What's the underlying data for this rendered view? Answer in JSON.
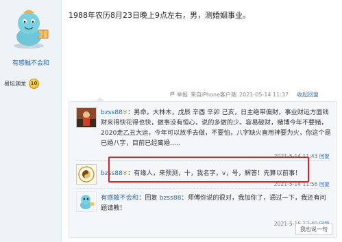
{
  "sidebar": {
    "username": "有感触不会和",
    "rank_label": "易坛渊龙",
    "level": "10"
  },
  "post": {
    "text": "1988年农历8月23日晚上9点左右，男，测婚姻事业。",
    "report": "举报",
    "source": "来自iPhone客户端",
    "date": "2021-05-14 11:37",
    "collapse_reply": "收起回复"
  },
  "replies": [
    {
      "name": "bzss88",
      "text": "：男命，大林木，戊辰 辛酉 辛卯 己亥，日主绝带偏财，事业财运方面钱财来得快花得也快，做事没有恒心，说的多做的少。容易破财，赌博今年不要赌，2020走乙丑大运，今年可以放手去做，不要怕，八字缺火喜用神要为火，你这个是已婚八字，目前已经离婚.....",
      "time": "2021-5-14 11:43",
      "reply": "回复"
    },
    {
      "name": "bzss88",
      "text": "：有缘人，来预测，十，我名字，v，号，解答！先算以前事！",
      "time": "2021-5-14 11:56",
      "reply": "回复"
    },
    {
      "name": "有感触不会和",
      "reply_word": "：回复",
      "target": "bzss88",
      "text": "：师傅你说的很对，我加你了，通过一下，我还有问题请教！",
      "time": "2021-5-15 12:40",
      "reply": "回复"
    }
  ],
  "say_button": "我也说一句"
}
